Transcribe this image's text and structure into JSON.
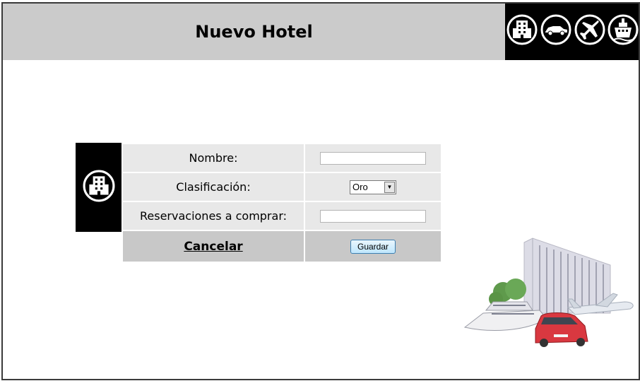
{
  "header": {
    "title": "Nuevo Hotel",
    "nav_icons": [
      "hotel-icon",
      "car-icon",
      "airplane-icon",
      "ship-icon"
    ]
  },
  "form": {
    "section_icon": "hotel-icon",
    "nombre_label": "Nombre:",
    "nombre_value": "",
    "clasificacion_label": "Clasificación:",
    "clasificacion_value": "Oro",
    "reservaciones_label": "Reservaciones a comprar:",
    "reservaciones_value": "",
    "cancel_label": "Cancelar",
    "save_label": "Guardar"
  },
  "colors": {
    "header_bg": "#cbcbcb",
    "icon_bar_bg": "#000000",
    "row_bg": "#e8e8e8",
    "action_row_bg": "#c8c8c8"
  }
}
